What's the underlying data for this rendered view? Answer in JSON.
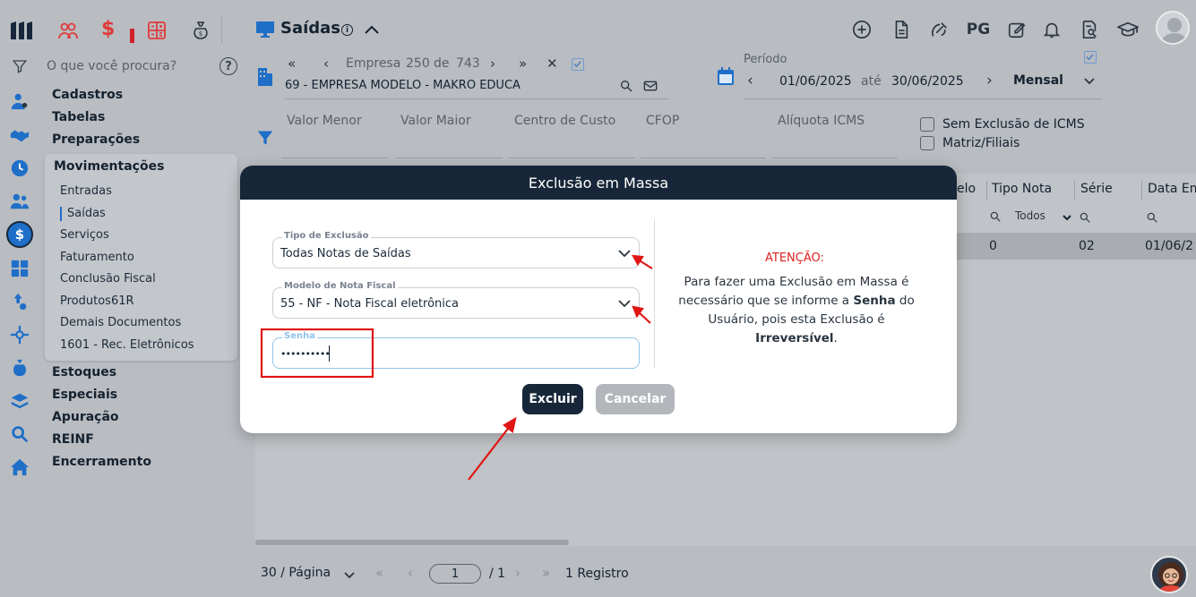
{
  "sidebar": {
    "search_placeholder": "O que você procura?",
    "menu": [
      "Cadastros",
      "Tabelas",
      "Preparações"
    ],
    "movimentacoes": {
      "title": "Movimentações",
      "items": [
        "Entradas",
        "Saídas",
        "Serviços",
        "Faturamento",
        "Conclusão Fiscal",
        "Produtos61R",
        "Demais Documentos",
        "1601 - Rec. Eletrônicos"
      ],
      "active": "Saídas"
    },
    "menu_bottom": [
      "Estoques",
      "Especiais",
      "Apuração",
      "REINF",
      "Encerramento"
    ]
  },
  "header": {
    "title": "Saídas",
    "top_icons": [
      "plus-circle-icon",
      "document-icon",
      "satellite-icon",
      "pg-button",
      "edit-icon",
      "bell-icon",
      "search-document-icon",
      "graduation-cap-icon",
      "user-avatar"
    ],
    "pg_label": "PG"
  },
  "empresa": {
    "nav_label": "Empresa",
    "current": "250",
    "of": "de",
    "total": "743",
    "name": "69 - EMPRESA MODELO - MAKRO EDUCA"
  },
  "periodo": {
    "label": "Período",
    "start": "01/06/2025",
    "ate": "até",
    "end": "30/06/2025",
    "mode": "Mensal"
  },
  "filters": {
    "valor_menor": "Valor Menor",
    "valor_maior": "Valor Maior",
    "centro_custo": "Centro de Custo",
    "cfop": "CFOP",
    "aliquota_icms": "Alíquota ICMS",
    "sem_exclusao_icms": "Sem Exclusão de ICMS",
    "matriz_filiais": "Matriz/Filiais"
  },
  "grid": {
    "columns": [
      "elo",
      "Tipo Nota",
      "Série",
      "Data Em"
    ],
    "tipo_nota_filter": "Todos",
    "row": [
      "0",
      "02",
      "01/06/2"
    ]
  },
  "dialog": {
    "title": "Exclusão em Massa",
    "tipo_exclusao_label": "Tipo de Exclusão",
    "tipo_exclusao_value": "Todas Notas de Saídas",
    "modelo_label": "Modelo de Nota Fiscal",
    "modelo_value": "55 - NF - Nota Fiscal eletrônica",
    "senha_label": "Senha",
    "senha_value": "••••••••••",
    "atencao": "ATENÇÃO:",
    "msg_part1": "Para fazer uma Exclusão em Massa é necessário que se informe a ",
    "msg_bold1": "Senha",
    "msg_part2": " do Usuário, pois esta Exclusão é ",
    "msg_bold2": "Irreversível",
    "msg_part3": ".",
    "excluir_label": "Excluir",
    "cancelar_label": "Cancelar"
  },
  "pagination": {
    "per_page": "30 / Página",
    "page": "1",
    "total_pages": "/ 1",
    "records": "1 Registro"
  },
  "colors": {
    "navy": "#172739",
    "danger": "#e02020",
    "accent_blue": "#1f6fc8"
  }
}
